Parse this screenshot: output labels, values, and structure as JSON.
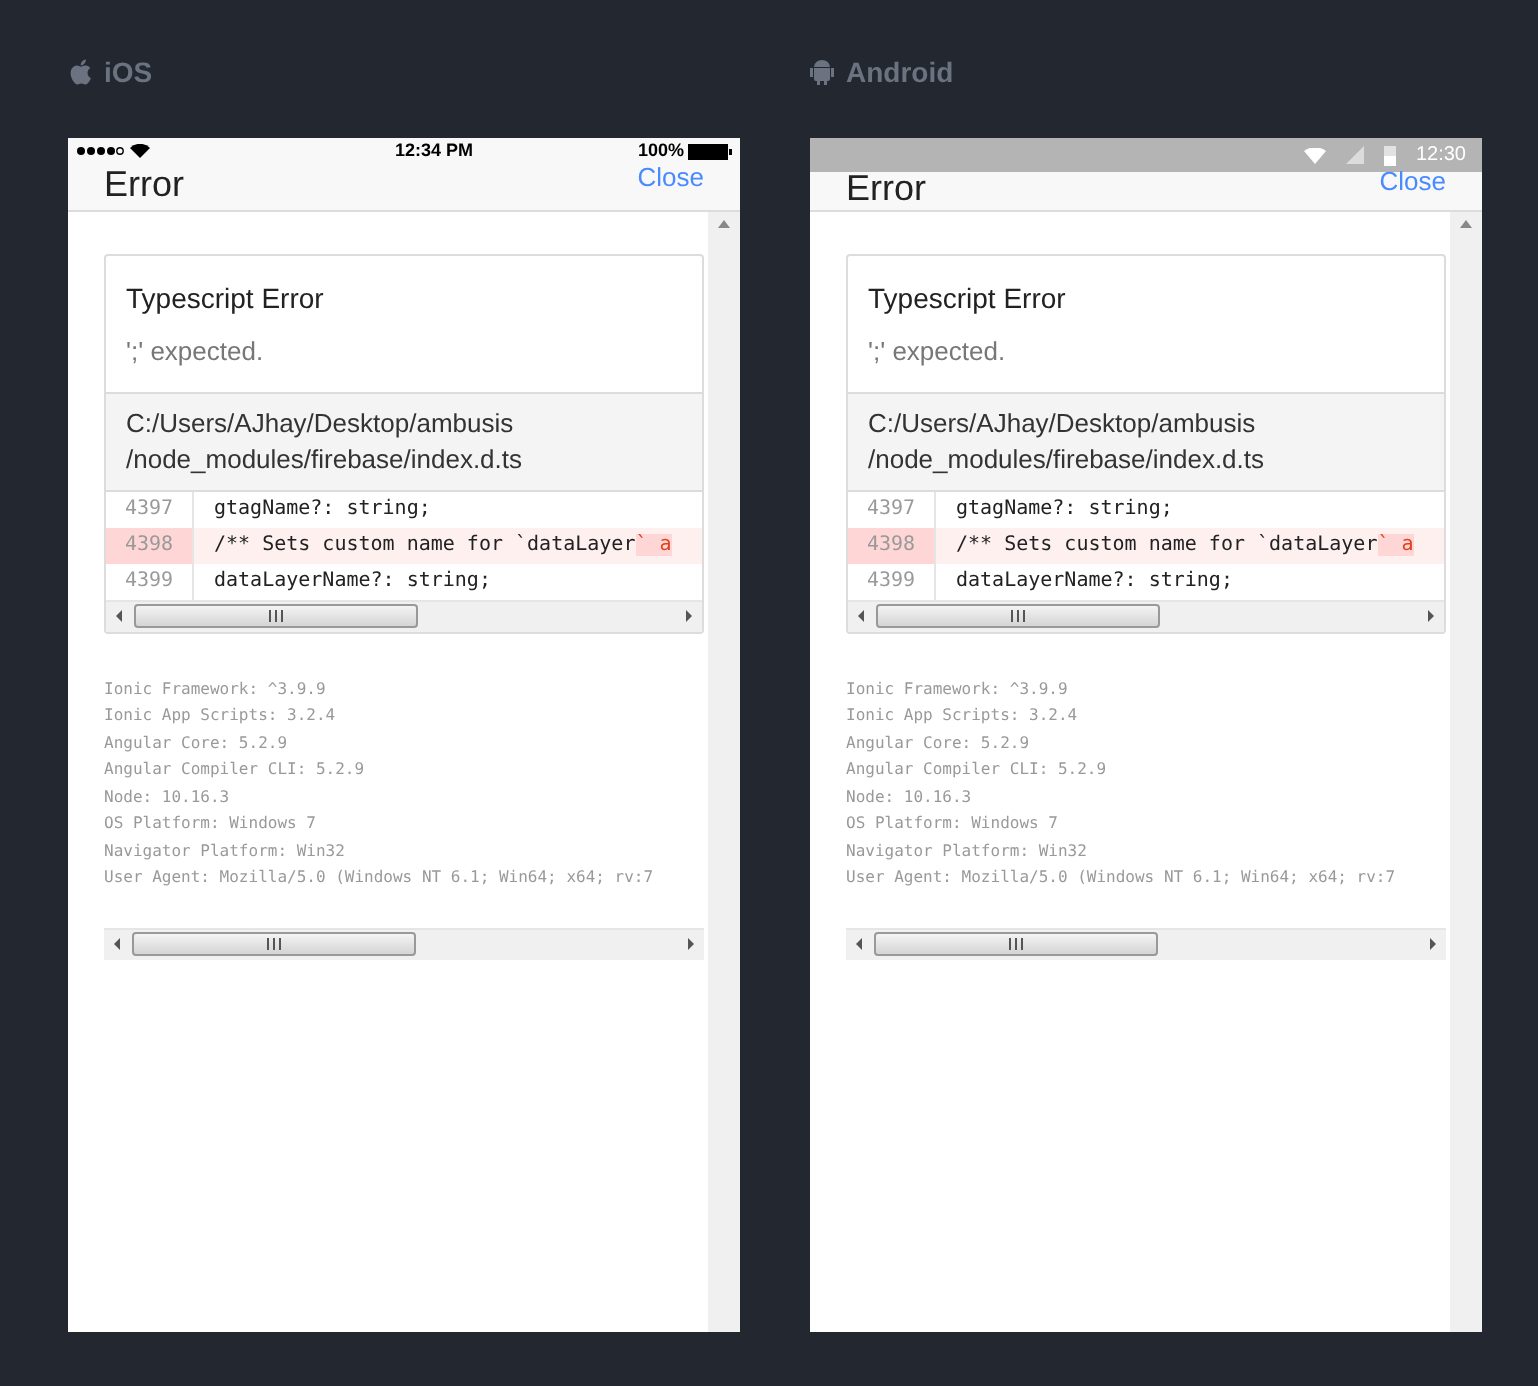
{
  "devices": [
    {
      "kind": "ios",
      "label": "iOS",
      "status_bar": {
        "time": "12:34 PM",
        "battery": "100%"
      },
      "header": {
        "title": "Error",
        "close": "Close"
      },
      "error": {
        "title": "Typescript Error",
        "message": "';' expected.",
        "file": "C:/Users/AJhay/Desktop/ambusis /node_modules/firebase/index.d.ts",
        "lines": [
          {
            "number": "4397",
            "code": "gtagName?: string;",
            "highlighted": false
          },
          {
            "number": "4398",
            "code": "/** Sets custom name for `dataLayer",
            "error_part": "` a",
            "highlighted": true
          },
          {
            "number": "4399",
            "code": "dataLayerName?: string;",
            "highlighted": false
          }
        ]
      },
      "environment": [
        "Ionic Framework: ^3.9.9",
        "Ionic App Scripts: 3.2.4",
        "Angular Core: 5.2.9",
        "Angular Compiler CLI: 5.2.9",
        "Node: 10.16.3",
        "OS Platform: Windows 7",
        "Navigator Platform: Win32",
        "User Agent: Mozilla/5.0 (Windows NT 6.1; Win64; x64; rv:7"
      ]
    },
    {
      "kind": "android",
      "label": "Android",
      "status_bar": {
        "time": "12:30"
      },
      "header": {
        "title": "Error",
        "close": "Close"
      },
      "error": {
        "title": "Typescript Error",
        "message": "';' expected.",
        "file": "C:/Users/AJhay/Desktop/ambusis /node_modules/firebase/index.d.ts",
        "lines": [
          {
            "number": "4397",
            "code": "gtagName?: string;",
            "highlighted": false
          },
          {
            "number": "4398",
            "code": "/** Sets custom name for `dataLayer",
            "error_part": "` a",
            "highlighted": true
          },
          {
            "number": "4399",
            "code": "dataLayerName?: string;",
            "highlighted": false
          }
        ]
      },
      "environment": [
        "Ionic Framework: ^3.9.9",
        "Ionic App Scripts: 3.2.4",
        "Angular Core: 5.2.9",
        "Angular Compiler CLI: 5.2.9",
        "Node: 10.16.3",
        "OS Platform: Windows 7",
        "Navigator Platform: Win32",
        "User Agent: Mozilla/5.0 (Windows NT 6.1; Win64; x64; rv:7"
      ]
    }
  ]
}
